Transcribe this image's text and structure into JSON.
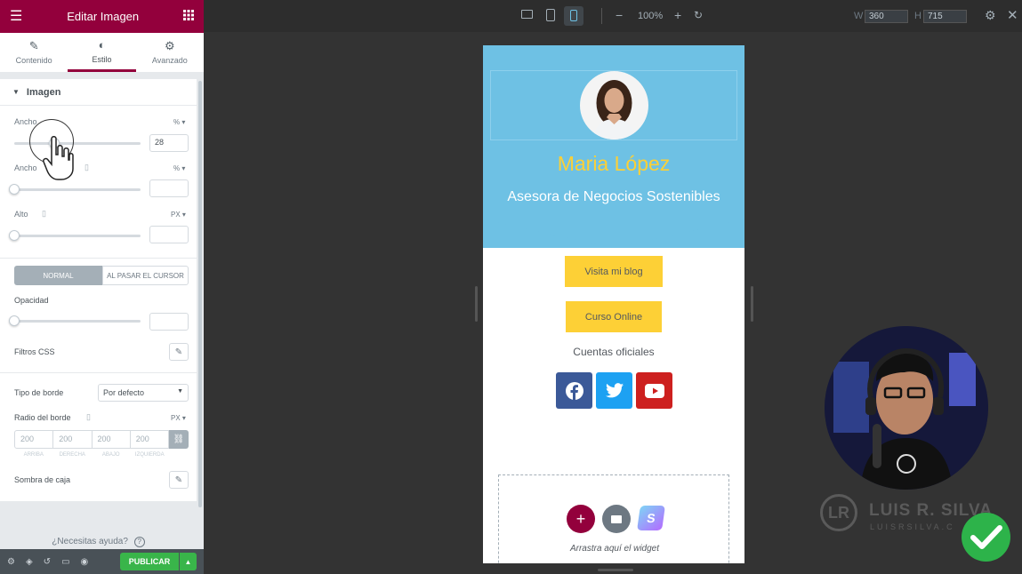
{
  "panel": {
    "title": "Editar Imagen",
    "tabs": [
      {
        "label": "Contenido",
        "icon": "pencil-icon"
      },
      {
        "label": "Estilo",
        "icon": "contrast-icon"
      },
      {
        "label": "Avanzado",
        "icon": "gear-icon"
      }
    ],
    "section_title": "Imagen",
    "width_label": "Ancho",
    "width_unit": "% ▾",
    "width_value": "28",
    "maxwidth_label": "Ancho",
    "maxwidth_unit": "% ▾",
    "height_label": "Alto",
    "height_unit": "PX ▾",
    "state_tabs": [
      "NORMAL",
      "AL PASAR EL CURSOR"
    ],
    "opacity_label": "Opacidad",
    "css_filters_label": "Filtros CSS",
    "border_type_label": "Tipo de borde",
    "border_type_value": "Por defecto",
    "border_radius_label": "Radio del borde",
    "border_radius_unit": "PX ▾",
    "radius_placeholders": [
      "200",
      "200",
      "200",
      "200"
    ],
    "radius_sides": [
      "ARRIBA",
      "DERECHA",
      "ABAJO",
      "IZQUIERDA"
    ],
    "box_shadow_label": "Sombra de caja",
    "help_label": "¿Necesitas ayuda?",
    "publish_label": "PUBLICAR"
  },
  "topbar": {
    "zoom": "100%",
    "width_label": "W",
    "width_value": "360",
    "height_label": "H",
    "height_value": "715"
  },
  "preview": {
    "name": "Maria López",
    "subtitle": "Asesora de Negocios Sostenibles",
    "btn1": "Visita mi blog",
    "btn2": "Curso Online",
    "social_title": "Cuentas oficiales",
    "drop_text": "Arrastra aquí el widget"
  },
  "watermark": {
    "name": "LUIS R. SILVA",
    "site": "LUISRSILVA.C"
  },
  "colors": {
    "brand": "#93003c",
    "hero": "#6ec1e4",
    "name": "#fdd036",
    "facebook": "#3b5998",
    "twitter": "#1da1f2",
    "youtube": "#cd201f",
    "publish": "#39b54a"
  }
}
